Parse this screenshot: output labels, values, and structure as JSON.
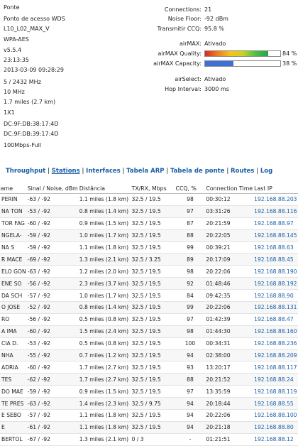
{
  "status_left": {
    "mode": "Ponte",
    "mode_ap": "Ponto de acesso WDS",
    "ssid": "L10_L02_MAX_V",
    "security": "WPA-AES",
    "version": "v5.5.4",
    "uptime": "23:13:35",
    "date": "2013-03-09 09:28:29",
    "frequency": "5 / 2432 MHz",
    "channel_width": "10 MHz",
    "distance": "1.7 miles (2.7 km)",
    "chains": "1X1",
    "wlan0_mac": "DC:9F:DB:38:17:4D",
    "lan_mac": "DC:9F:DB:39:17:4D",
    "lan_speed": "100Mbps-Full"
  },
  "status_right": {
    "connections_label": "Connections:",
    "connections_value": "21",
    "noise_label": "Noise Floor:",
    "noise_value": "-92 dBm",
    "ccq_label": "Transmitir CCQ:",
    "ccq_value": "95.8 %",
    "airmax_label": "airMAX:",
    "airmax_value": "Ativado",
    "quality_label": "airMAX Quality:",
    "quality_pct_text": "84 %",
    "quality_value": 84,
    "capacity_label": "airMAX Capacity:",
    "capacity_pct_text": "38 %",
    "capacity_value": 38,
    "airselect_label": "airSelect:",
    "airselect_value": "Ativado",
    "hop_label": "Hop Interval:",
    "hop_value": "3000 ms"
  },
  "colors": {
    "quality_gradient": [
      "#d92b1f",
      "#f07c1e",
      "#f4c31c",
      "#c9d41a",
      "#48c04a",
      "#2aa347"
    ],
    "capacity_fill": "#3d6fd6",
    "link": "#1a5fa8"
  },
  "tabs": [
    {
      "label": "Throughput",
      "active": false
    },
    {
      "label": "Stations",
      "active": true
    },
    {
      "label": "Interfaces",
      "active": false
    },
    {
      "label": "Tabela ARP",
      "active": false
    },
    {
      "label": "Tabela de ponte",
      "active": false
    },
    {
      "label": "Routes",
      "active": false
    },
    {
      "label": "Log",
      "active": false
    }
  ],
  "table": {
    "headers": [
      "Name",
      "Sinal / Noise, dBm",
      "Distância",
      "TX/RX, Mbps",
      "CCQ, %",
      "Connection Time",
      "Last IP"
    ],
    "rows": [
      [
        "PERIN",
        "-63 / -92",
        "1.1 miles (1.8 km)",
        "32.5 / 19.5",
        "98",
        "00:30:12",
        "192.168.88.203"
      ],
      [
        "NA TON",
        "-53 / -92",
        "0.8 miles (1.4 km)",
        "32.5 / 19.5",
        "97",
        "03:31:26",
        "192.168.88.116"
      ],
      [
        "TOR FAG",
        "-60 / -92",
        "0.9 miles (1.5 km)",
        "32.5 / 19.5",
        "87",
        "20:21:59",
        "192.168.88.97"
      ],
      [
        "NGELA-",
        "-59 / -92",
        "1.0 miles (1.7 km)",
        "32.5 / 19.5",
        "88",
        "20:22:05",
        "192.168.88.145"
      ],
      [
        "NA S",
        "-59 / -92",
        "1.1 miles (1.8 km)",
        "32.5 / 19.5",
        "99",
        "00:39:21",
        "192.168.88.63"
      ],
      [
        "R MACE",
        "-69 / -92",
        "1.3 miles (2.1 km)",
        "32.5 / 3.25",
        "89",
        "20:17:09",
        "192.168.88.45"
      ],
      [
        "ELO GON",
        "-63 / -92",
        "1.2 miles (2.0 km)",
        "32.5 / 19.5",
        "98",
        "20:22:06",
        "192.168.88.190"
      ],
      [
        "ENE SO",
        "-56 / -92",
        "2.3 miles (3.7 km)",
        "32.5 / 19.5",
        "92",
        "01:48:46",
        "192.168.88.192"
      ],
      [
        "DA SCH",
        "-57 / -92",
        "1.0 miles (1.7 km)",
        "32.5 / 19.5",
        "84",
        "09:42:35",
        "192.168.88.90"
      ],
      [
        "O JOSE",
        "-52 / -92",
        "0.8 miles (1.4 km)",
        "32.5 / 19.5",
        "99",
        "20:22:06",
        "192.168.88.131"
      ],
      [
        "RO",
        "-56 / -92",
        "0.5 miles (0.8 km)",
        "32.5 / 19.5",
        "97",
        "01:42:39",
        "192.168.88.47"
      ],
      [
        "A IMA",
        "-60 / -92",
        "1.5 miles (2.4 km)",
        "32.5 / 19.5",
        "98",
        "01:44:30",
        "192.168.88.160"
      ],
      [
        "CIA D.",
        "-53 / -92",
        "0.5 miles (0.8 km)",
        "32.5 / 19.5",
        "100",
        "00:34:31",
        "192.168.88.236"
      ],
      [
        "NHA",
        "-55 / -92",
        "0.7 miles (1.2 km)",
        "32.5 / 19.5",
        "94",
        "02:38:00",
        "192.168.88.209"
      ],
      [
        "ADRIA",
        "-60 / -92",
        "1.7 miles (2.7 km)",
        "32.5 / 19.5",
        "93",
        "13:20:17",
        "192.168.88.117"
      ],
      [
        "TES",
        "-62 / -92",
        "1.7 miles (2.7 km)",
        "32.5 / 19.5",
        "88",
        "20:21:52",
        "192.168.88.24"
      ],
      [
        "DO MAE",
        "-59 / -92",
        "0.9 miles (1.5 km)",
        "32.5 / 19.5",
        "97",
        "13:35:59",
        "192.168.88.119"
      ],
      [
        "TE PRES",
        "-63 / -92",
        "1.4 miles (2.3 km)",
        "32.5 / 9.75",
        "94",
        "20:18:44",
        "192.168.88.55"
      ],
      [
        "E SEBO",
        "-57 / -92",
        "1.1 miles (1.8 km)",
        "32.5 / 19.5",
        "94",
        "20:22:06",
        "192.168.88.100"
      ],
      [
        "E",
        "-61 / -92",
        "1.1 miles (1.8 km)",
        "32.5 / 19.5",
        "94",
        "20:21:18",
        "192.168.88.80"
      ],
      [
        "BERTOL",
        "-67 / -92",
        "1.3 miles (2.1 km)",
        "0 / 3",
        "-",
        "01:21:51",
        "192.168.88.12"
      ]
    ]
  }
}
